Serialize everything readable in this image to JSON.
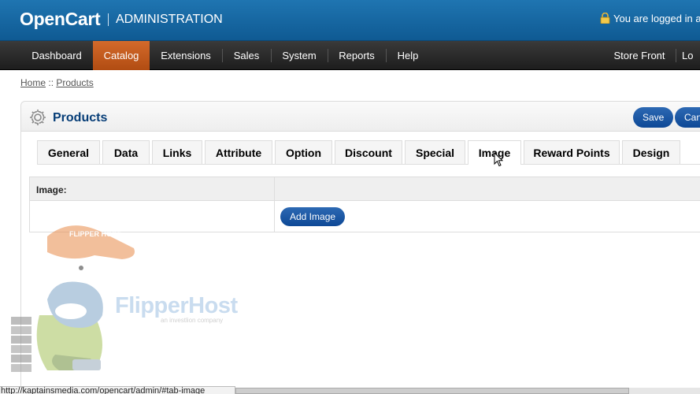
{
  "header": {
    "brand": "OpenCart",
    "subtitle": "ADMINISTRATION",
    "login_text": "You are logged in as"
  },
  "menu": [
    {
      "label": "Dashboard",
      "active": false
    },
    {
      "label": "Catalog",
      "active": true
    },
    {
      "label": "Extensions",
      "active": false
    },
    {
      "label": "Sales",
      "active": false
    },
    {
      "label": "System",
      "active": false
    },
    {
      "label": "Reports",
      "active": false
    },
    {
      "label": "Help",
      "active": false
    },
    {
      "label": "Store Front",
      "active": false
    },
    {
      "label": "Lo",
      "active": false
    }
  ],
  "breadcrumb": {
    "home": "Home",
    "sep": "::",
    "current": "Products"
  },
  "page": {
    "title": "Products",
    "save_label": "Save",
    "cancel_label": "Can"
  },
  "tabs": [
    {
      "label": "General",
      "selected": false
    },
    {
      "label": "Data",
      "selected": false
    },
    {
      "label": "Links",
      "selected": false
    },
    {
      "label": "Attribute",
      "selected": false
    },
    {
      "label": "Option",
      "selected": false
    },
    {
      "label": "Discount",
      "selected": false
    },
    {
      "label": "Special",
      "selected": false
    },
    {
      "label": "Image",
      "selected": true
    },
    {
      "label": "Reward Points",
      "selected": false
    },
    {
      "label": "Design",
      "selected": false
    }
  ],
  "image_table": {
    "header": "Image:",
    "add_button": "Add Image"
  },
  "watermark": {
    "name": "FlipperHost",
    "tagline": "an investlion company",
    "cap_text": "FLIPPER HOST"
  },
  "status_bar": {
    "url": "http://kaptainsmedia.com/opencart/admin/#tab-image"
  },
  "colors": {
    "header_blue": "#1a6aa6",
    "menu_active": "#c75b1c",
    "title_blue": "#063d77",
    "button_blue": "#1a56a3"
  }
}
